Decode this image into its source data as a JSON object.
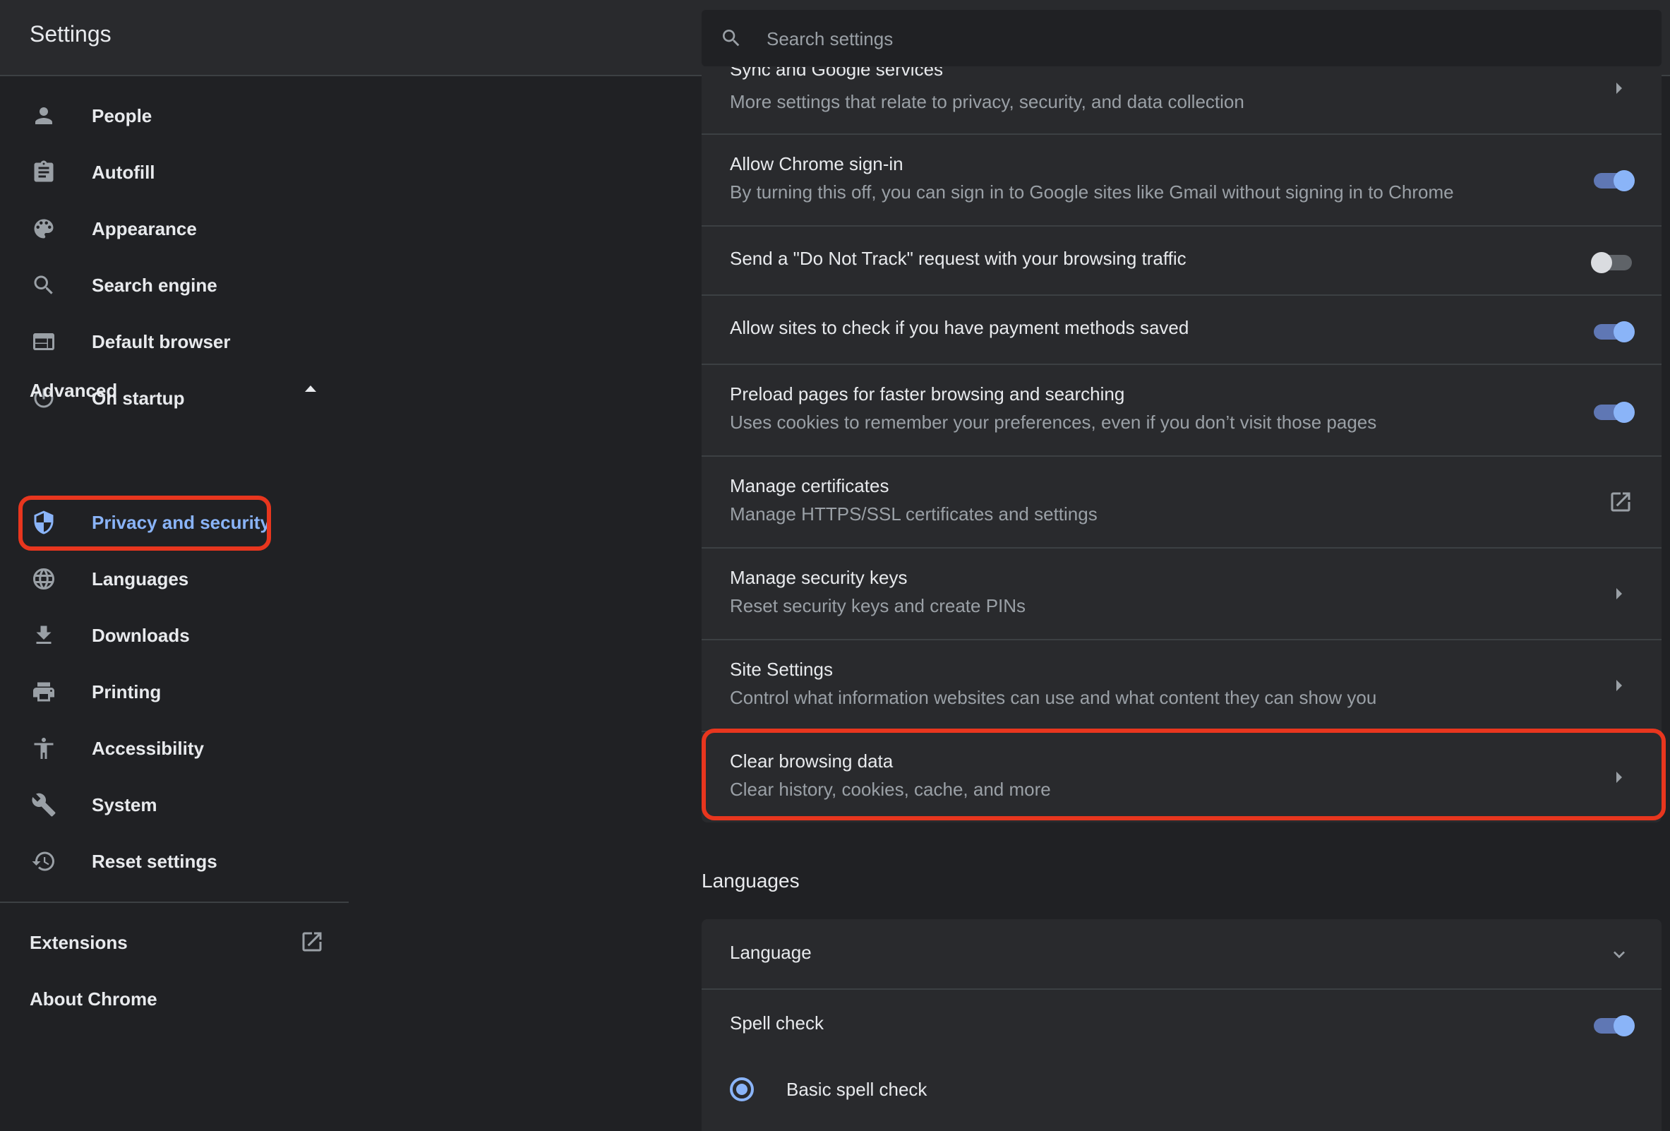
{
  "header": {
    "title": "Settings",
    "search_placeholder": "Search settings"
  },
  "sidebar": {
    "items": [
      {
        "label": "People",
        "icon": "person-icon"
      },
      {
        "label": "Autofill",
        "icon": "clipboard-icon"
      },
      {
        "label": "Appearance",
        "icon": "palette-icon"
      },
      {
        "label": "Search engine",
        "icon": "search-icon"
      },
      {
        "label": "Default browser",
        "icon": "browser-window-icon"
      },
      {
        "label": "On startup",
        "icon": "power-icon"
      }
    ],
    "advanced_label": "Advanced",
    "advanced_items": [
      {
        "label": "Privacy and security",
        "icon": "shield-icon",
        "active": true
      },
      {
        "label": "Languages",
        "icon": "globe-icon"
      },
      {
        "label": "Downloads",
        "icon": "download-icon"
      },
      {
        "label": "Printing",
        "icon": "printer-icon"
      },
      {
        "label": "Accessibility",
        "icon": "accessibility-icon"
      },
      {
        "label": "System",
        "icon": "wrench-icon"
      },
      {
        "label": "Reset settings",
        "icon": "history-icon"
      }
    ],
    "extensions_label": "Extensions",
    "about_label": "About Chrome"
  },
  "privacy": {
    "rows": [
      {
        "title": "Sync and Google services",
        "subtitle": "More settings that relate to privacy, security, and data collection",
        "control": "arrow"
      },
      {
        "title": "Allow Chrome sign-in",
        "subtitle": "By turning this off, you can sign in to Google sites like Gmail without signing in to Chrome",
        "control": "toggle",
        "checked": true
      },
      {
        "title": "Send a \"Do Not Track\" request with your browsing traffic",
        "control": "toggle",
        "checked": false
      },
      {
        "title": "Allow sites to check if you have payment methods saved",
        "control": "toggle",
        "checked": true
      },
      {
        "title": "Preload pages for faster browsing and searching",
        "subtitle": "Uses cookies to remember your preferences, even if you don’t visit those pages",
        "control": "toggle",
        "checked": true
      },
      {
        "title": "Manage certificates",
        "subtitle": "Manage HTTPS/SSL certificates and settings",
        "control": "external-link"
      },
      {
        "title": "Manage security keys",
        "subtitle": "Reset security keys and create PINs",
        "control": "arrow"
      },
      {
        "title": "Site Settings",
        "subtitle": "Control what information websites can use and what content they can show you",
        "control": "arrow"
      },
      {
        "title": "Clear browsing data",
        "subtitle": "Clear history, cookies, cache, and more",
        "control": "arrow"
      }
    ]
  },
  "languages": {
    "section_title": "Languages",
    "language_label": "Language",
    "spell_check_label": "Spell check",
    "spell_check_on": true,
    "basic_spell_check_label": "Basic spell check"
  },
  "colors": {
    "accent": "#8ab4f8",
    "highlight": "#e8361e",
    "background": "#202124",
    "card": "#292a2d"
  }
}
